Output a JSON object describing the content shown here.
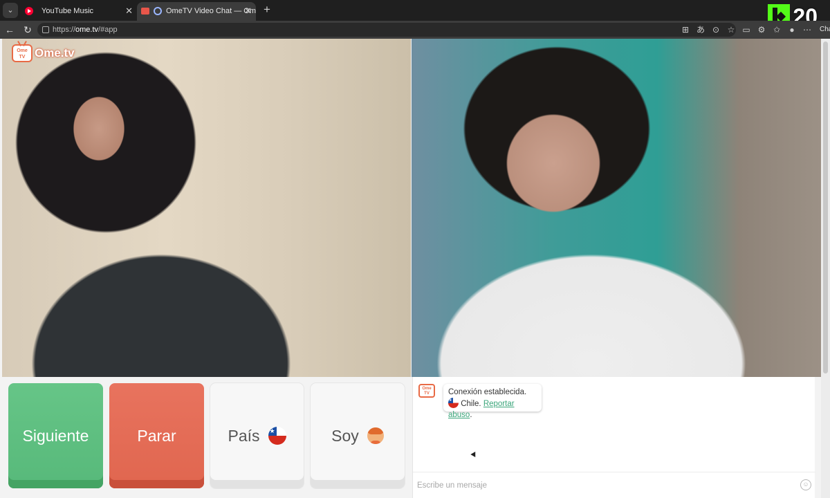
{
  "browser": {
    "tabs": [
      {
        "title": "YouTube Music",
        "close": "✕"
      },
      {
        "title": "OmeTV Video Chat — Omegl",
        "close": "✕"
      }
    ],
    "new_tab": "+",
    "url_scheme": "https://",
    "url_host": "ome.tv",
    "url_path": "/#app",
    "chat_button": "Chat"
  },
  "overlay": {
    "viewer_count": "20"
  },
  "site": {
    "logo_text": "Ome.tv",
    "logo_badge": "Ome TV"
  },
  "controls": {
    "next": "Siguiente",
    "stop": "Parar",
    "country": "País",
    "gender": "Soy"
  },
  "chat": {
    "bot_badge": "Ome TV",
    "message_line1": "Conexión establecida.",
    "message_country": "Chile.",
    "report_link": "Reportar abuso",
    "report_suffix": ".",
    "input_placeholder": "Escribe un mensaje"
  },
  "icons": {
    "tab_list": "chevron-down-icon",
    "back": "arrow-left-icon",
    "reload": "reload-icon",
    "emoji": "smiley-icon"
  },
  "colors": {
    "next_green": "#57b97a",
    "stop_red": "#e0664f",
    "link_green": "#3aa57a",
    "brand_orange": "#e86a45"
  }
}
